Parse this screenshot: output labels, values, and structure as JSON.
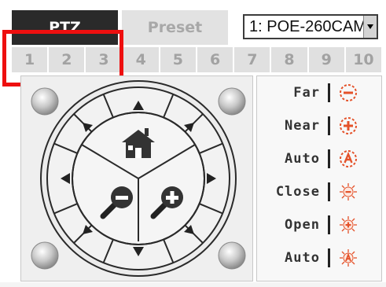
{
  "tabs": {
    "ptz": "PTZ",
    "preset": "Preset"
  },
  "camera_select": {
    "value": "1: POE-260CAM"
  },
  "preset_numbers": [
    "1",
    "2",
    "3",
    "4",
    "5",
    "6",
    "7",
    "8",
    "9",
    "10"
  ],
  "camera_controls": [
    {
      "label": "Far",
      "icon": "zoom-far-icon"
    },
    {
      "label": "Near",
      "icon": "zoom-near-icon"
    },
    {
      "label": "Auto",
      "icon": "zoom-auto-icon"
    },
    {
      "label": "Close",
      "icon": "iris-close-icon"
    },
    {
      "label": "Open",
      "icon": "iris-open-icon"
    },
    {
      "label": "Auto",
      "icon": "iris-auto-icon"
    }
  ],
  "colors": {
    "active_tab": "#2a2a2a",
    "highlight": "#ee0f0f",
    "icon_accent": "#e4522a"
  }
}
